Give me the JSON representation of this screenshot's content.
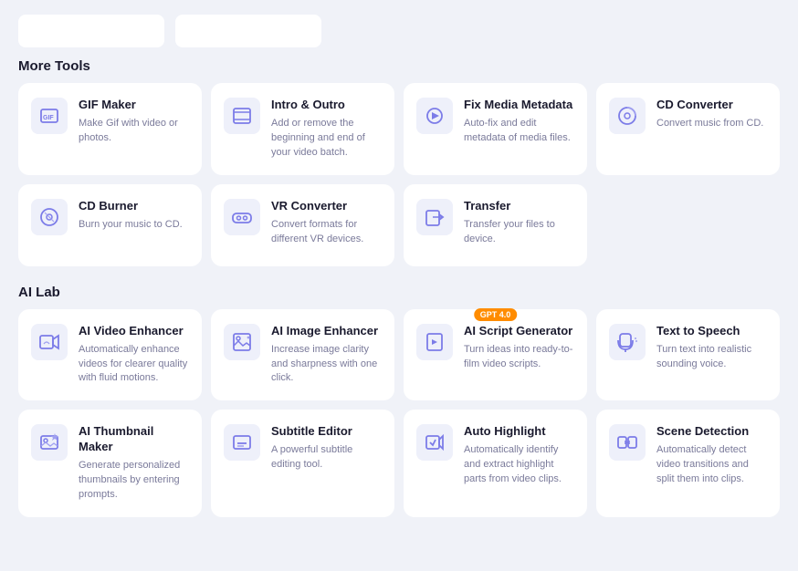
{
  "topBar": {
    "btn1": "",
    "btn2": ""
  },
  "moreTools": {
    "label": "More Tools",
    "cards": [
      {
        "id": "gif-maker",
        "name": "GIF Maker",
        "desc": "Make Gif with video or photos.",
        "iconType": "gif"
      },
      {
        "id": "intro-outro",
        "name": "Intro & Outro",
        "desc": "Add or remove the beginning and end of your video batch.",
        "iconType": "intro"
      },
      {
        "id": "fix-media-metadata",
        "name": "Fix Media Metadata",
        "desc": "Auto-fix and edit metadata of media files.",
        "iconType": "metadata"
      },
      {
        "id": "cd-converter",
        "name": "CD Converter",
        "desc": "Convert music from CD.",
        "iconType": "cd"
      },
      {
        "id": "cd-burner",
        "name": "CD Burner",
        "desc": "Burn your music to CD.",
        "iconType": "burner"
      },
      {
        "id": "vr-converter",
        "name": "VR Converter",
        "desc": "Convert formats for different VR devices.",
        "iconType": "vr"
      },
      {
        "id": "transfer",
        "name": "Transfer",
        "desc": "Transfer your files to device.",
        "iconType": "transfer"
      }
    ]
  },
  "aiLab": {
    "label": "AI Lab",
    "cards": [
      {
        "id": "ai-video-enhancer",
        "name": "AI Video Enhancer",
        "desc": "Automatically enhance videos for clearer quality with fluid motions.",
        "iconType": "ai-video",
        "badge": null
      },
      {
        "id": "ai-image-enhancer",
        "name": "AI Image Enhancer",
        "desc": "Increase image clarity and sharpness with one click.",
        "iconType": "ai-image",
        "badge": null
      },
      {
        "id": "ai-script-generator",
        "name": "AI Script Generator",
        "desc": "Turn ideas into ready-to-film video scripts.",
        "iconType": "ai-script",
        "badge": "GPT 4.0"
      },
      {
        "id": "text-to-speech",
        "name": "Text to Speech",
        "desc": "Turn text into realistic sounding voice.",
        "iconType": "tts",
        "badge": null
      },
      {
        "id": "ai-thumbnail-maker",
        "name": "AI Thumbnail Maker",
        "desc": "Generate personalized thumbnails by entering prompts.",
        "iconType": "thumbnail",
        "badge": null
      },
      {
        "id": "subtitle-editor",
        "name": "Subtitle Editor",
        "desc": "A powerful subtitle editing tool.",
        "iconType": "subtitle",
        "badge": null
      },
      {
        "id": "auto-highlight",
        "name": "Auto Highlight",
        "desc": "Automatically identify and extract highlight parts from video clips.",
        "iconType": "highlight",
        "badge": null
      },
      {
        "id": "scene-detection",
        "name": "Scene Detection",
        "desc": "Automatically detect video transitions and split them into clips.",
        "iconType": "scene",
        "badge": null
      }
    ]
  }
}
